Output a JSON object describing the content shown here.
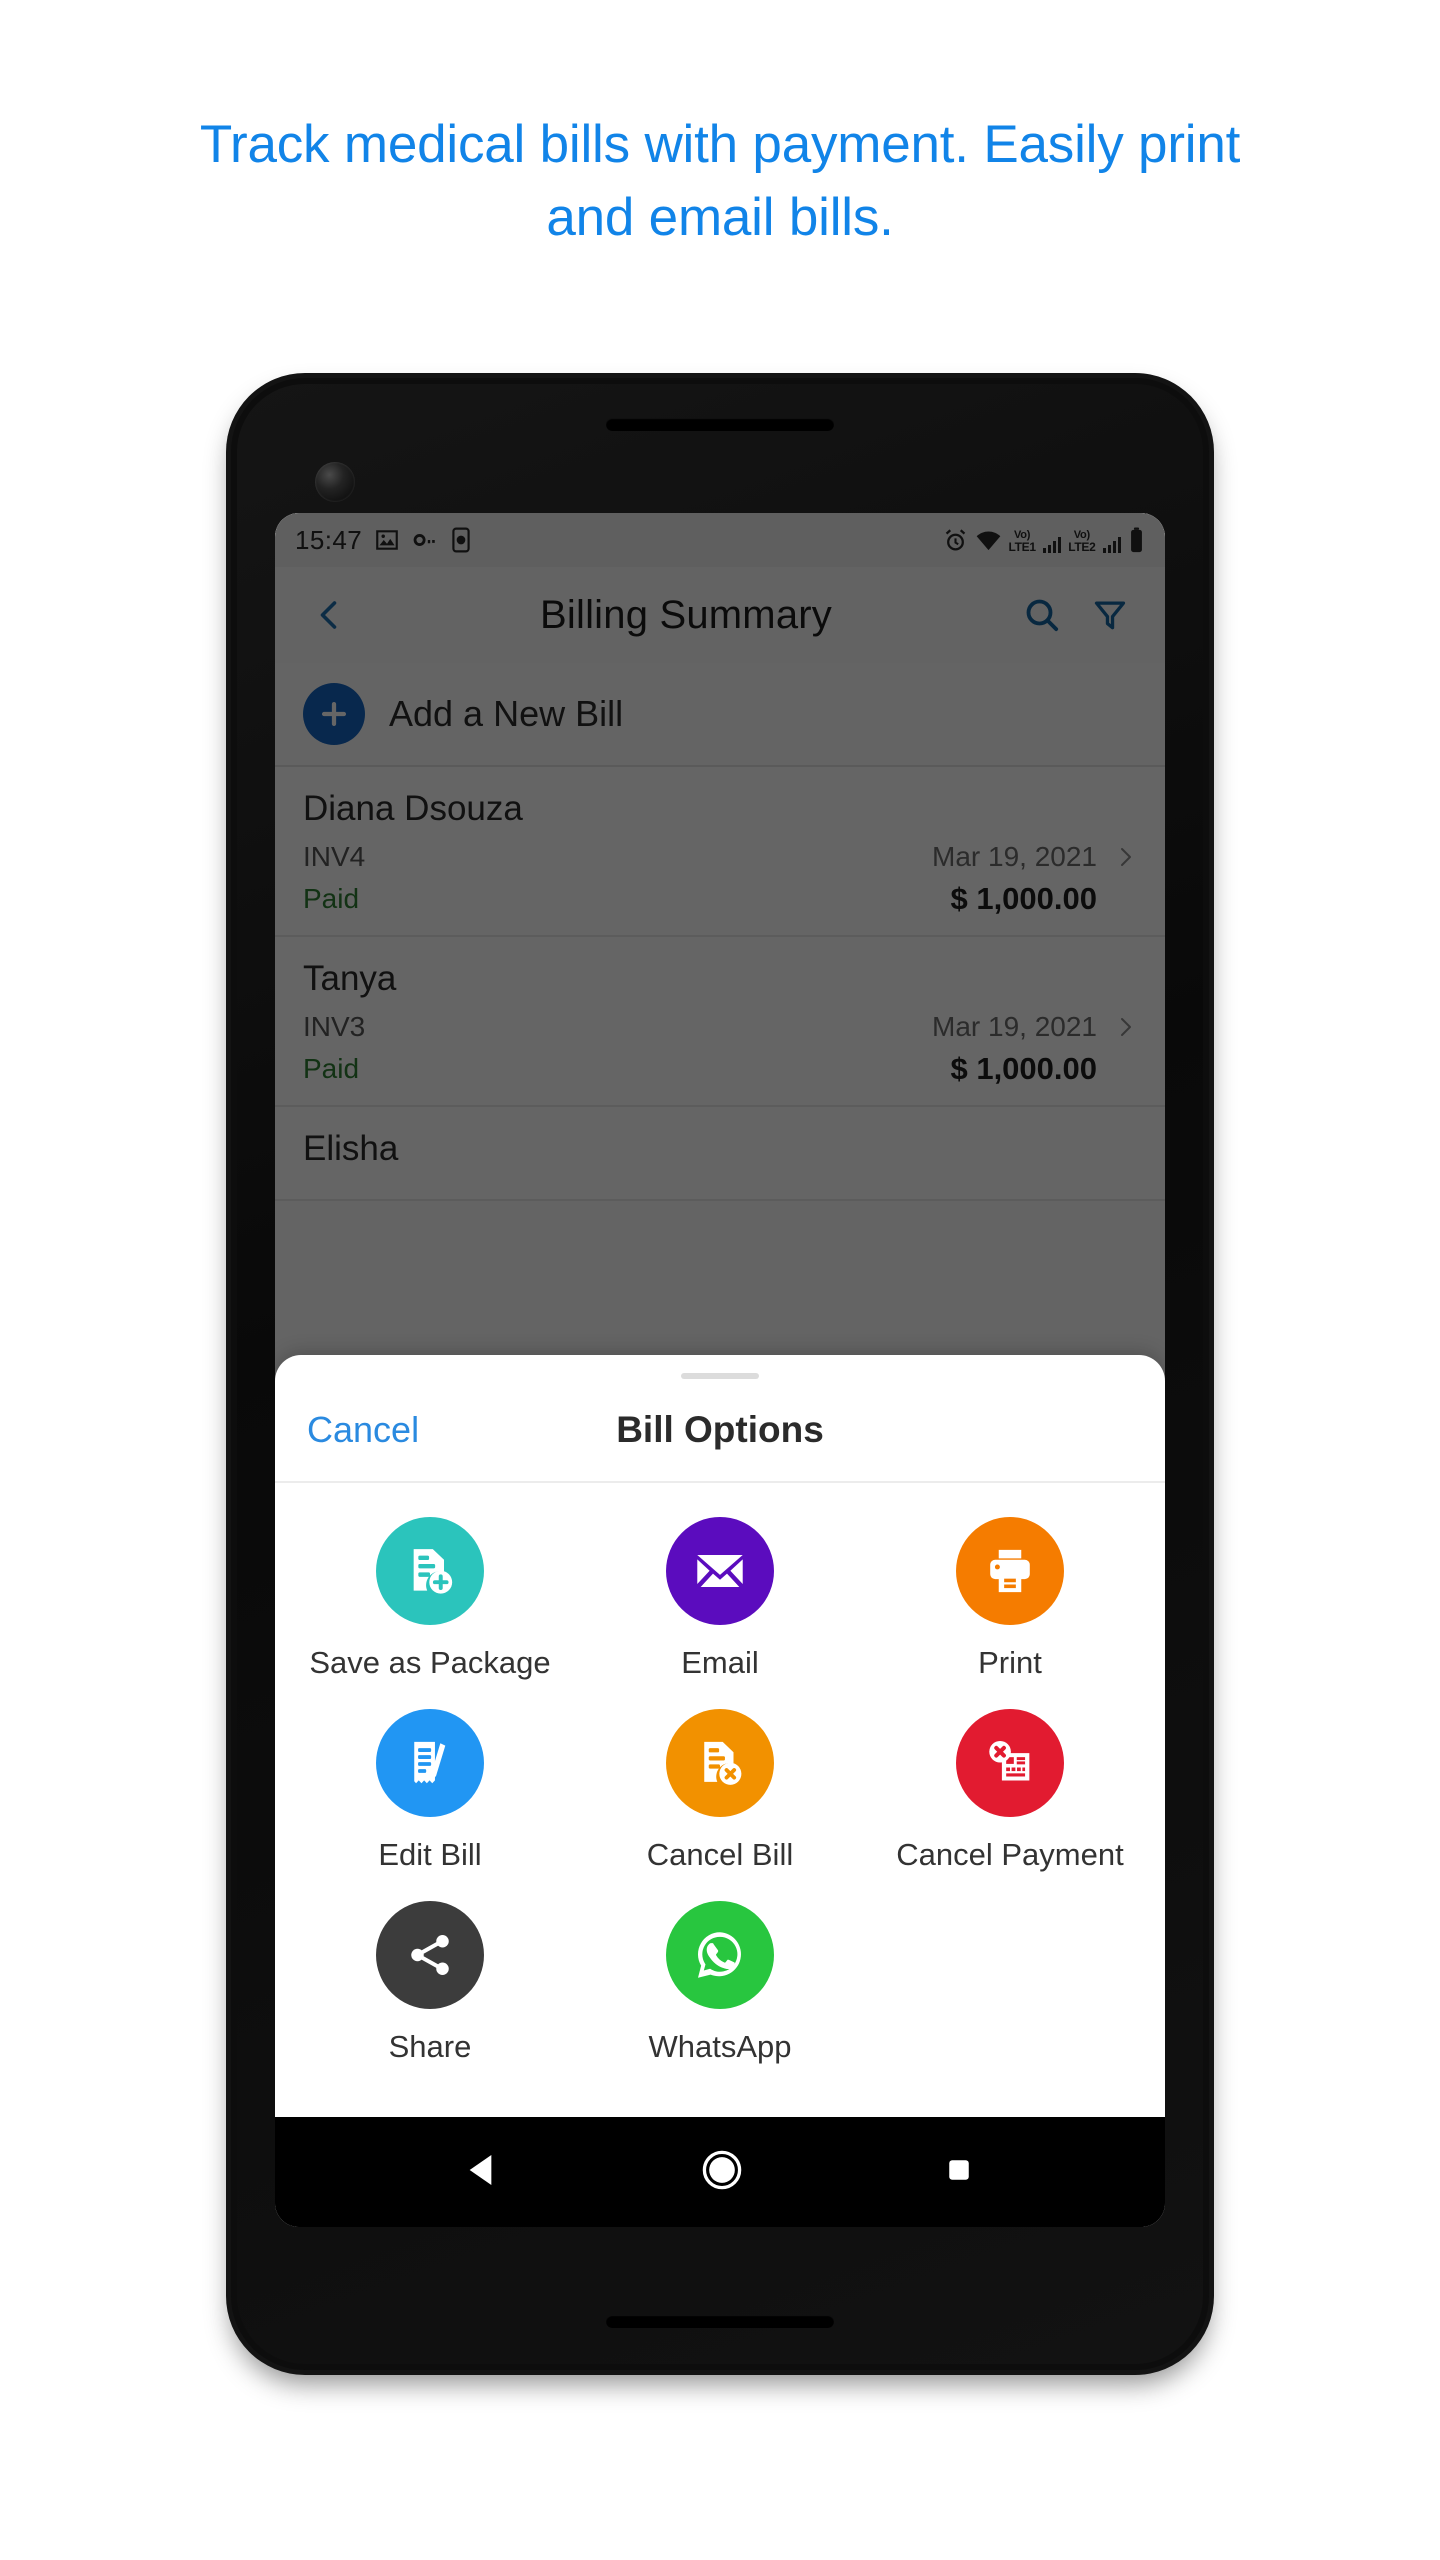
{
  "headline": "Track medical bills with payment. Easily print and email bills.",
  "colors": {
    "headline": "#1184e8",
    "accent_blue": "#2a8ae0",
    "paid_green": "#2e7d32",
    "plus_blue": "#1565c0"
  },
  "status_bar": {
    "time": "15:47",
    "left_icons": [
      "image-icon",
      "key-icon",
      "device-icon"
    ],
    "right_icons": [
      "alarm-icon",
      "wifi-icon",
      "battery-icon"
    ],
    "sim1": {
      "volte": "Vo)",
      "network": "LTE1"
    },
    "sim2": {
      "volte": "Vo)",
      "network": "LTE2"
    }
  },
  "app_bar": {
    "back_icon": "chevron-left-icon",
    "title": "Billing Summary",
    "search_icon": "search-icon",
    "filter_icon": "filter-icon"
  },
  "add_new": {
    "icon": "plus-icon",
    "label": "Add a New Bill"
  },
  "bills": [
    {
      "name": "Diana Dsouza",
      "invoice": "INV4",
      "date": "Mar 19, 2021",
      "status": "Paid",
      "amount": "$ 1,000.00"
    },
    {
      "name": "Tanya",
      "invoice": "INV3",
      "date": "Mar 19, 2021",
      "status": "Paid",
      "amount": "$ 1,000.00"
    },
    {
      "name": "Elisha",
      "invoice": "",
      "date": "",
      "status": "",
      "amount": ""
    }
  ],
  "sheet": {
    "cancel_label": "Cancel",
    "title": "Bill Options",
    "options": [
      {
        "label": "Save as Package",
        "icon": "file-add-icon",
        "color": "#2bc4bc"
      },
      {
        "label": "Email",
        "icon": "envelope-icon",
        "color": "#5b0cbe"
      },
      {
        "label": "Print",
        "icon": "printer-icon",
        "color": "#f57c00"
      },
      {
        "label": "Edit Bill",
        "icon": "receipt-pencil-icon",
        "color": "#2196f3"
      },
      {
        "label": "Cancel Bill",
        "icon": "file-x-icon",
        "color": "#f29100"
      },
      {
        "label": "Cancel Payment",
        "icon": "payment-x-icon",
        "color": "#e21b30"
      },
      {
        "label": "Share",
        "icon": "share-icon",
        "color": "#3c3c3c"
      },
      {
        "label": "WhatsApp",
        "icon": "whatsapp-icon",
        "color": "#28c63f"
      }
    ]
  },
  "nav_bar": {
    "back": "triangle-back-icon",
    "home": "circle-home-icon",
    "recents": "square-recents-icon"
  }
}
